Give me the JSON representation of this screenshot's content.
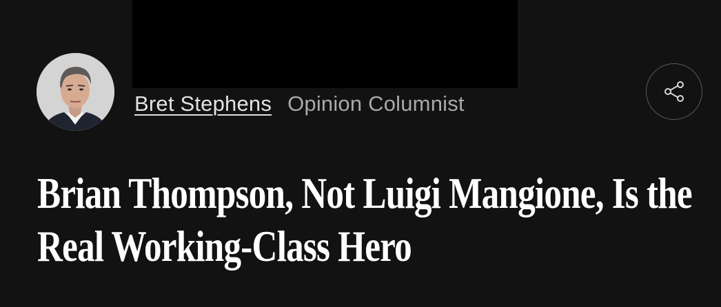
{
  "byline": {
    "author": "Bret Stephens",
    "role": "Opinion Columnist"
  },
  "headline": {
    "line1": "Brian Thompson, Not Luigi Mangione, Is the",
    "line2": "Real Working-Class Hero"
  },
  "icons": {
    "share": "share-icon"
  },
  "colors": {
    "background": "#121212",
    "text": "#ffffff",
    "role": "#a9a9a9",
    "link": "#e3e3e3"
  }
}
